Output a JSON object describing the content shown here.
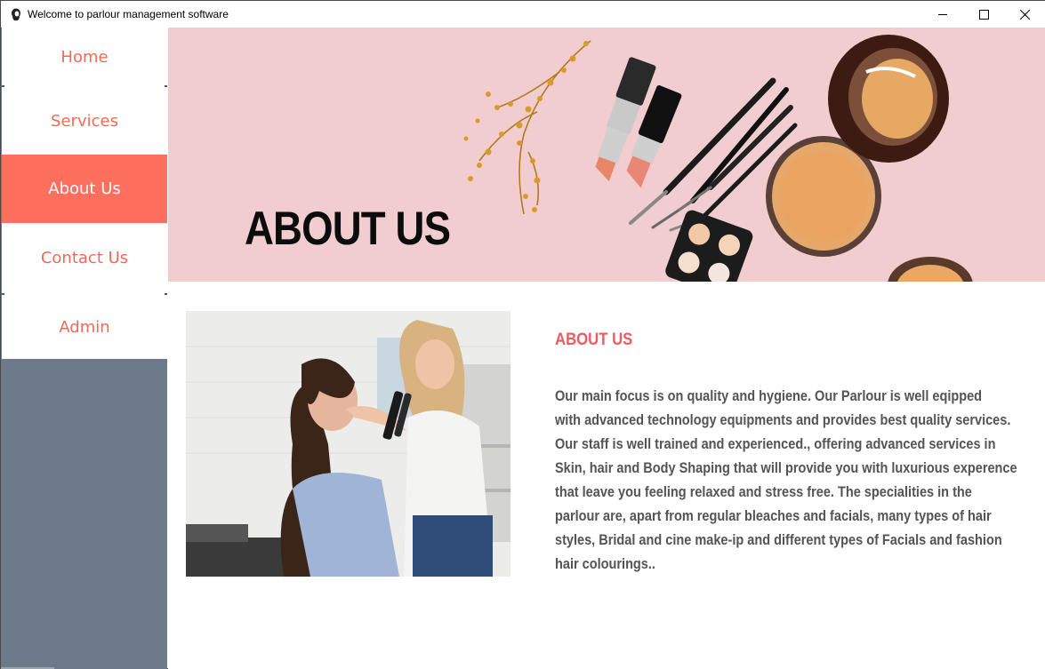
{
  "window": {
    "title": "Welcome to parlour management software",
    "controls": [
      "minimize-icon",
      "maximize-icon",
      "close-icon"
    ]
  },
  "sidebar": {
    "items": [
      {
        "label": "Home",
        "active": false
      },
      {
        "label": "Services",
        "active": false
      },
      {
        "label": "About Us",
        "active": true
      },
      {
        "label": "Contact Us",
        "active": false
      },
      {
        "label": "Admin",
        "active": false
      }
    ]
  },
  "banner": {
    "title": "ABOUT US"
  },
  "about": {
    "heading": "ABOUT US",
    "lines": [
      "Our main focus is on quality and hygiene. Our Parlour is well eqipped",
      "with advanced technology equipments and provides best quality services.",
      "Our staff is well trained and experienced., offering advanced services in",
      "Skin, hair and Body Shaping that will provide you  with luxurious experence",
      "that leave you feeling relaxed and stress free. The specialities in the",
      "parlour are, apart from regular bleaches and facials, many types of hair",
      "styles, Bridal and cine make-ip  and different types of Facials and fashion",
      "hair colourings.."
    ]
  },
  "colors": {
    "accent": "#ff6f5e",
    "nav_text": "#f06a55",
    "sidebar_bg": "#6c7a8b",
    "banner_bg": "#f1cdd0",
    "heading": "#ef5a62",
    "body_text": "#545454"
  }
}
